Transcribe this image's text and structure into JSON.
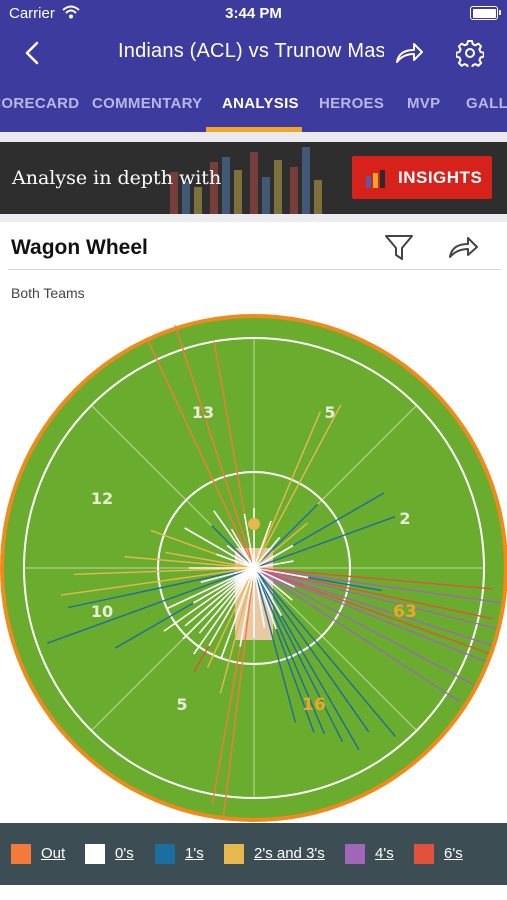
{
  "status_bar": {
    "carrier": "Carrier",
    "time": "3:44 PM"
  },
  "nav": {
    "title": "Indians (ACL) vs Trunow Masters"
  },
  "tabs": [
    {
      "label": "SCORECARD",
      "active": false
    },
    {
      "label": "COMMENTARY",
      "active": false
    },
    {
      "label": "ANALYSIS",
      "active": true
    },
    {
      "label": "HEROES",
      "active": false
    },
    {
      "label": "MVP",
      "active": false
    },
    {
      "label": "GALLERY",
      "active": false
    }
  ],
  "banner": {
    "text": "Analyse in depth with",
    "button_label": "INSIGHTS"
  },
  "wagon_wheel": {
    "title": "Wagon Wheel",
    "subtitle": "Both Teams",
    "sector_runs": [
      {
        "label": "13",
        "color": "#e8ecd8"
      },
      {
        "label": "5",
        "color": "#e8ecd8"
      },
      {
        "label": "2",
        "color": "#e8ecd8"
      },
      {
        "label": "63",
        "color": "#f0a526"
      },
      {
        "label": "16",
        "color": "#f0a526"
      },
      {
        "label": "5",
        "color": "#e8ecd8"
      },
      {
        "label": "10",
        "color": "#e8ecd8"
      },
      {
        "label": "12",
        "color": "#e8ecd8"
      }
    ],
    "colors": {
      "field": "#6aac2e",
      "boundary": "#f08a1c",
      "pitch": "#e9c9a4",
      "out": "#f47a3c",
      "zeros": "#ffffff",
      "ones": "#1a6ea0",
      "twos_threes": "#e7b84d",
      "fours": "#a066b8",
      "sixes": "#e0523c"
    }
  },
  "legend": [
    {
      "label": "Out",
      "color": "#f47a3c"
    },
    {
      "label": "0's",
      "color": "#ffffff"
    },
    {
      "label": "1's",
      "color": "#1a6ea0"
    },
    {
      "label": "2's and 3's",
      "color": "#e7b84d"
    },
    {
      "label": "4's",
      "color": "#a066b8"
    },
    {
      "label": "6's",
      "color": "#e0523c"
    }
  ]
}
